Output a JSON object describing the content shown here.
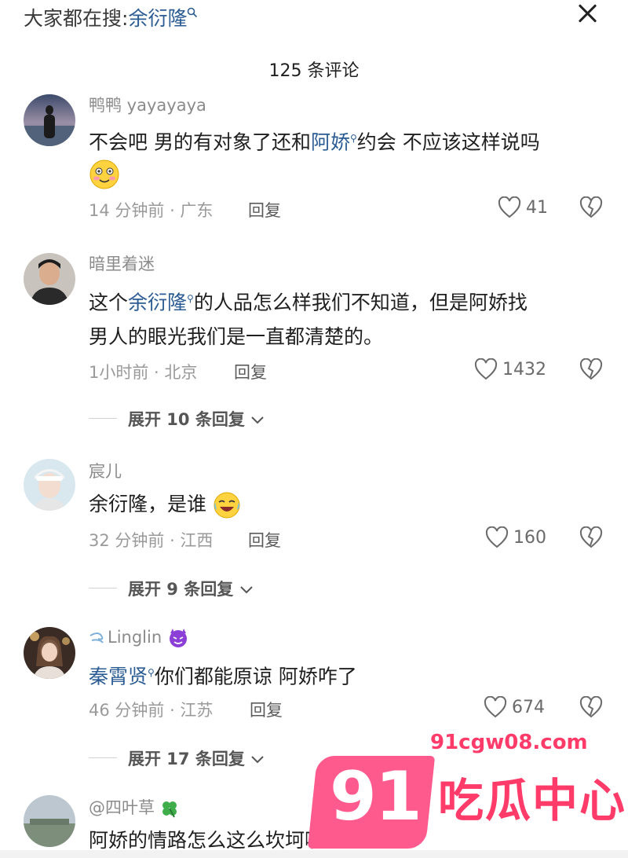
{
  "header": {
    "search_prefix": "大家都在搜:",
    "search_keyword": "余衍隆",
    "comment_count_title": "125 条评论"
  },
  "comments": [
    {
      "username": "鸭鸭 yayayaya",
      "text_before": "不会吧 男的有对象了还和",
      "link": "阿娇",
      "text_after": "约会 不应该这样说吗",
      "time_location": "14 分钟前 · 广东",
      "reply_label": "回复",
      "likes": "41"
    },
    {
      "username": "暗里着迷",
      "text_before": "这个",
      "link": "余衍隆",
      "text_after": "的人品怎么样我们不知道，但是阿娇找",
      "text_line2": "男人的眼光我们是一直都清楚的。",
      "time_location": "1小时前 · 北京",
      "reply_label": "回复",
      "likes": "1432",
      "expand_label": "展开 10 条回复"
    },
    {
      "username": "宸儿",
      "text": "余衍隆，是谁",
      "time_location": "32 分钟前 · 江西",
      "reply_label": "回复",
      "likes": "160",
      "expand_label": "展开 9 条回复"
    },
    {
      "username": "Linglin",
      "link": "秦霄贤",
      "text_after": "你们都能原谅  阿娇咋了",
      "time_location": "46 分钟前 · 江苏",
      "reply_label": "回复",
      "likes": "674",
      "expand_label": "展开 17 条回复"
    },
    {
      "username": "@四叶草",
      "text": "阿娇的情路怎么这么坎坷啊"
    }
  ],
  "watermark": {
    "url": "91cgw08.com",
    "number": "91",
    "name": "吃瓜中心"
  },
  "icons": {
    "search": "search-icon",
    "close": "close-icon",
    "like": "heart-icon",
    "dislike": "broken-heart-icon",
    "chevron": "chevron-down-icon"
  },
  "colors": {
    "link": "#2b5c93",
    "watermark": "#ff3b6a"
  }
}
